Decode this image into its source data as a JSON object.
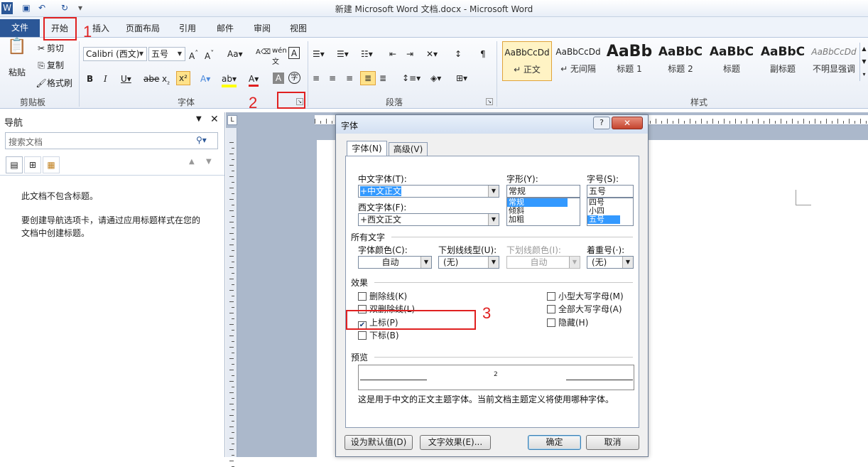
{
  "window": {
    "title": "新建 Microsoft Word 文档.docx - Microsoft Word",
    "file_tab": "文件"
  },
  "tabs": [
    "开始",
    "插入",
    "页面布局",
    "引用",
    "邮件",
    "审阅",
    "视图"
  ],
  "clipboard": {
    "paste": "粘贴",
    "cut": "剪切",
    "copy": "复制",
    "format_painter": "格式刷",
    "label": "剪贴板"
  },
  "font_group": {
    "font_name": "Calibri (西文)",
    "font_size": "五号",
    "label": "字体"
  },
  "paragraph_group": {
    "label": "段落"
  },
  "styles_group": {
    "label": "样式",
    "tiles": [
      {
        "sample": "AaBbCcDd",
        "name": "↵ 正文"
      },
      {
        "sample": "AaBbCcDd",
        "name": "↵ 无间隔"
      },
      {
        "sample": "AaBb",
        "name": "标题 1"
      },
      {
        "sample": "AaBbC",
        "name": "标题 2"
      },
      {
        "sample": "AaBbC",
        "name": "标题"
      },
      {
        "sample": "AaBbC",
        "name": "副标题"
      },
      {
        "sample": "AaBbCcDd",
        "name": "不明显强调"
      }
    ]
  },
  "nav": {
    "title": "导航",
    "search_placeholder": "搜索文档",
    "msg1": "此文档不包含标题。",
    "msg2a": "要创建导航选项卡，请通过应用标题样式在您的",
    "msg2b": "文档中创建标题。"
  },
  "dialog": {
    "title": "字体",
    "help": "?",
    "tab_font": "字体(N)",
    "tab_advanced": "高级(V)",
    "cn_font_label": "中文字体(T):",
    "cn_font_value": "+中文正文",
    "west_font_label": "西文字体(F):",
    "west_font_value": "+西文正文",
    "style_label": "字形(Y):",
    "style_value": "常规",
    "style_options": [
      "常规",
      "倾斜",
      "加粗"
    ],
    "size_label": "字号(S):",
    "size_value": "五号",
    "size_options": [
      "四号",
      "小四",
      "五号"
    ],
    "all_text": "所有文字",
    "font_color_label": "字体颜色(C):",
    "font_color_value": "自动",
    "underline_label": "下划线线型(U):",
    "underline_value": "(无)",
    "underline_color_label": "下划线颜色(I):",
    "underline_color_value": "自动",
    "emphasis_label": "着重号(·):",
    "emphasis_value": "(无)",
    "effects": "效果",
    "strike": "删除线(K)",
    "dstrike": "双删除线(L)",
    "superscript": "上标(P)",
    "subscript": "下标(B)",
    "small_caps": "小型大写字母(M)",
    "all_caps": "全部大写字母(A)",
    "hidden": "隐藏(H)",
    "preview": "预览",
    "preview_text": "2",
    "desc": "这是用于中文的正文主题字体。当前文档主题定义将使用哪种字体。",
    "btn_default": "设为默认值(D)",
    "btn_effects": "文字效果(E)...",
    "btn_ok": "确定",
    "btn_cancel": "取消"
  },
  "annotations": [
    "1",
    "2",
    "3"
  ]
}
